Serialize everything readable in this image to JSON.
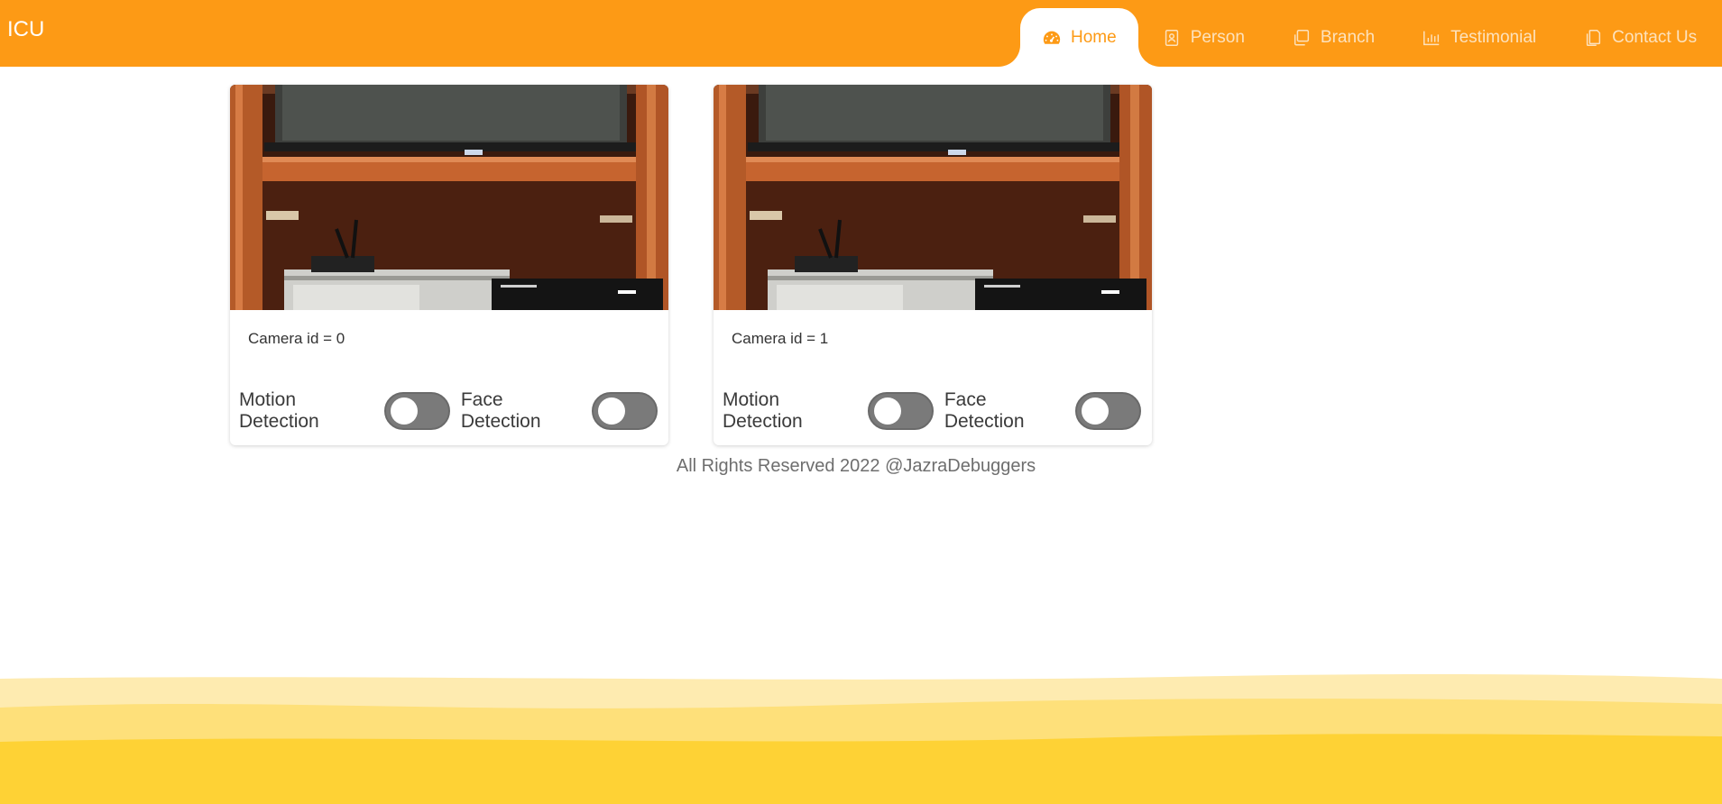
{
  "header": {
    "brand": "ICU",
    "nav": [
      {
        "label": "Home",
        "icon": "dashboard-icon",
        "active": true
      },
      {
        "label": "Person",
        "icon": "contact-card-icon",
        "active": false
      },
      {
        "label": "Branch",
        "icon": "copy-icon",
        "active": false
      },
      {
        "label": "Testimonial",
        "icon": "bar-chart-icon",
        "active": false
      },
      {
        "label": "Contact Us",
        "icon": "documents-icon",
        "active": false
      }
    ]
  },
  "cameras": [
    {
      "label": "Camera id = 0",
      "motion_label": "Motion Detection",
      "motion_on": false,
      "face_label": "Face Detection",
      "face_on": false
    },
    {
      "label": "Camera id = 1",
      "motion_label": "Motion Detection",
      "motion_on": false,
      "face_label": "Face Detection",
      "face_on": false
    }
  ],
  "footer": {
    "text": "All Rights Reserved 2022 @JazraDebuggers"
  },
  "colors": {
    "header": "#fd9a15",
    "wave_light": "#feebb0",
    "wave_mid": "#fee07a",
    "wave_dark": "#fed235"
  }
}
